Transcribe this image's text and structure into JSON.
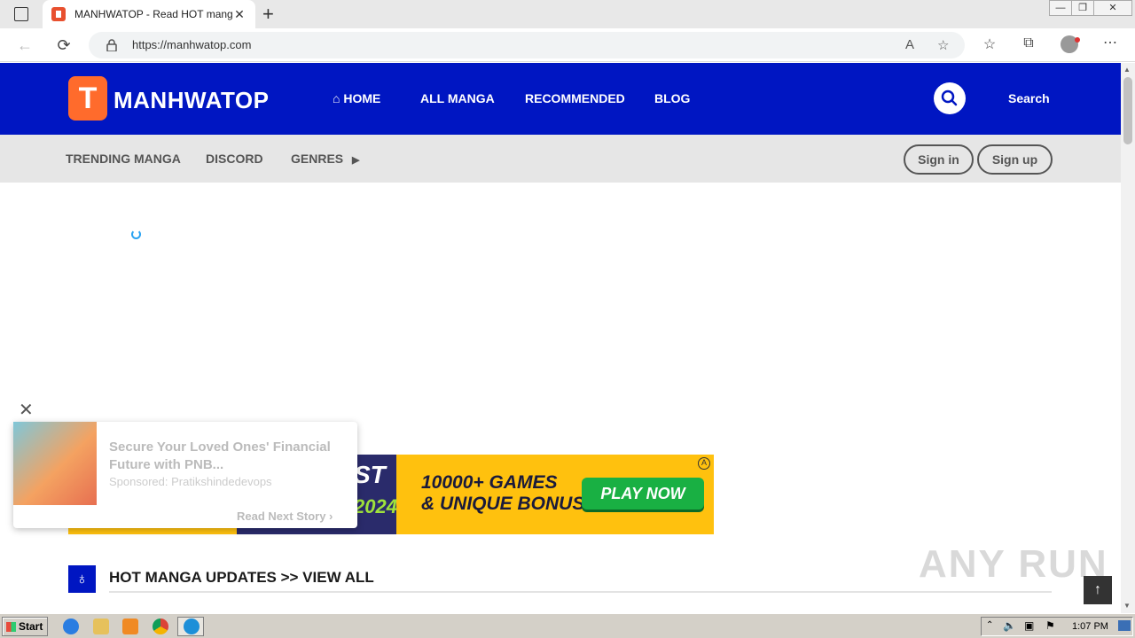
{
  "browser": {
    "tab_title": "MANHWATOP - Read HOT manga",
    "tab_close": "✕",
    "new_tab": "+",
    "url": "https://manhwatop.com",
    "window_controls": [
      "—",
      "❐",
      "✕"
    ]
  },
  "header": {
    "logo_mark": "T",
    "logo_text": "MANHWATOP",
    "nav": [
      {
        "label": "HOME",
        "icon": "home-icon"
      },
      {
        "label": "ALL MANGA"
      },
      {
        "label": "RECOMMENDED"
      },
      {
        "label": "BLOG"
      }
    ],
    "search_label": "Search"
  },
  "subnav": {
    "links": [
      "TRENDING MANGA",
      "DISCORD",
      "GENRES"
    ],
    "sign_in": "Sign in",
    "sign_up": "Sign up"
  },
  "ad": {
    "headline_line1": "10000+ GAMES",
    "headline_line2": "& UNIQUE BONUS",
    "cta": "PLAY NOW",
    "partial_top": "ST",
    "partial_year": "2024"
  },
  "popup": {
    "title": "Secure Your Loved Ones' Financial Future with PNB...",
    "sponsor": "Sponsored: Pratikshindedevops",
    "next": "Read Next Story"
  },
  "section": {
    "title": "HOT MANGA UPDATES >> VIEW ALL"
  },
  "watermark": "ANY RUN",
  "taskbar": {
    "start": "Start",
    "clock": "1:07 PM"
  },
  "colors": {
    "header_bg": "#0016c2",
    "logo_orange": "#ff6b2c",
    "ad_yellow": "#ffc10e",
    "cta_green": "#19b043"
  }
}
